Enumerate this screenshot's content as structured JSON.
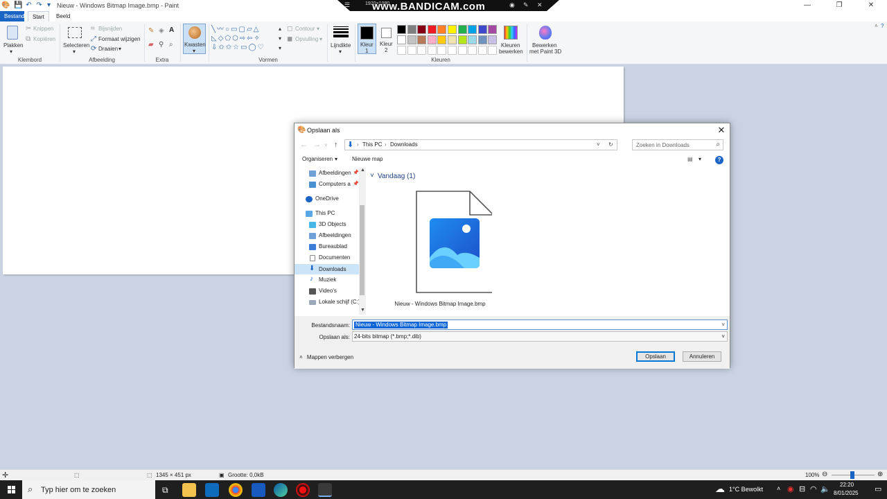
{
  "paint": {
    "window_title": "Nieuw - Windows Bitmap Image.bmp - Paint",
    "tabs": [
      "Bestand",
      "Start",
      "Beeld"
    ],
    "clipboard": {
      "paste": "Plakken",
      "cut": "Knippen",
      "copy": "Kopiëren",
      "label": "Klembord"
    },
    "image": {
      "select": "Selecteren",
      "crop": "Bijsnijden",
      "resize": "Formaat wijzigen",
      "rotate": "Draaien",
      "label": "Afbeelding"
    },
    "tools": {
      "label": "Extra"
    },
    "brushes": {
      "label": "Kwasten"
    },
    "shapes": {
      "outline": "Contour",
      "fill": "Opvulling",
      "label": "Vormen"
    },
    "size": {
      "label": "Lijndikte"
    },
    "colors": {
      "color1": "Kleur",
      "color1_num": "1",
      "color2": "Kleur",
      "color2_num": "2",
      "edit": "Kleuren",
      "edit2": "bewerken",
      "paint3d": "Bewerken",
      "paint3d2": "met Paint 3D",
      "label": "Kleuren",
      "row1": [
        "#000000",
        "#7f7f7f",
        "#880015",
        "#ed1c24",
        "#ff7f27",
        "#fff200",
        "#22b14c",
        "#00a2e8",
        "#3f48cc",
        "#a349a4"
      ],
      "row2": [
        "#ffffff",
        "#c3c3c3",
        "#b97a57",
        "#ffaec9",
        "#ffc90e",
        "#efe4b0",
        "#b5e61d",
        "#99d9ea",
        "#7092be",
        "#c8bfe7"
      ]
    },
    "status": {
      "dimensions": "1345 × 451 px",
      "size": "Grootte: 0,0kB",
      "zoom": "100%"
    }
  },
  "bandicam": {
    "resolution": "1920×1080",
    "brand": "www.BANDICAM.com"
  },
  "dialog": {
    "title": "Opslaan als",
    "breadcrumb": [
      "This PC",
      "Downloads"
    ],
    "search_placeholder": "Zoeken in Downloads",
    "organize": "Organiseren",
    "new_folder": "Nieuwe map",
    "nav_items": [
      {
        "label": "Afbeeldingen",
        "pinned": true
      },
      {
        "label": "Computers a",
        "pinned": true
      },
      {
        "label": "OneDrive"
      },
      {
        "label": "This PC"
      },
      {
        "label": "3D Objects"
      },
      {
        "label": "Afbeeldingen"
      },
      {
        "label": "Bureaublad"
      },
      {
        "label": "Documenten"
      },
      {
        "label": "Downloads"
      },
      {
        "label": "Muziek"
      },
      {
        "label": "Video's"
      },
      {
        "label": "Lokale schijf (C:)"
      }
    ],
    "group_header": "Vandaag (1)",
    "file_name_display": "Nieuw - Windows Bitmap Image.bmp",
    "filename_label": "Bestandsnaam:",
    "filename_value": "Nieuw - Windows Bitmap Image.bmp",
    "savetype_label": "Opslaan als:",
    "savetype_value": "24-bits bitmap (*.bmp;*.dib)",
    "hide_folders": "Mappen verbergen",
    "save": "Opslaan",
    "cancel": "Annuleren"
  },
  "taskbar": {
    "search_placeholder": "Typ hier om te zoeken",
    "weather": "1°C  Bewolkt",
    "time": "22:20",
    "date": "8/01/2025"
  }
}
